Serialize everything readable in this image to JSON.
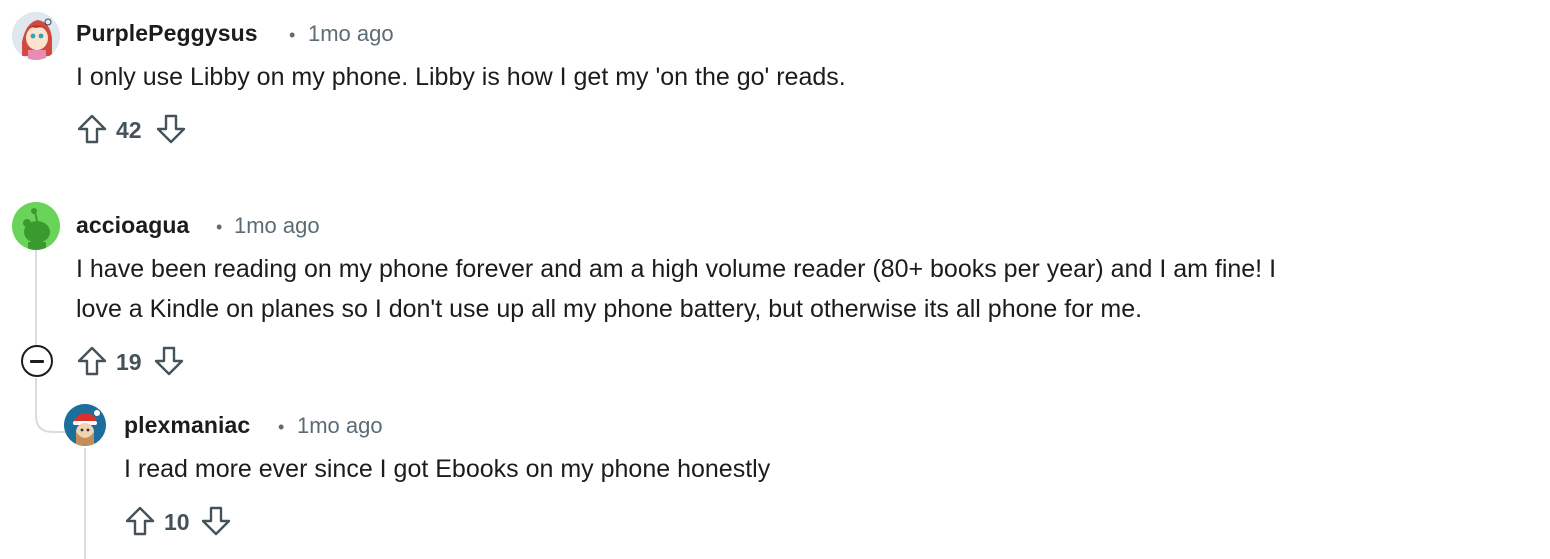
{
  "comments": [
    {
      "username": "PurplePeggysus",
      "separator": "•",
      "age": "1mo ago",
      "body": [
        "I only use Libby on my phone. Libby is how I get my 'on the go' reads."
      ],
      "votes": "42",
      "avatar_icon": "anime-avatar-icon"
    },
    {
      "username": "accioagua",
      "separator": "•",
      "age": "1mo ago",
      "body": [
        "I have been reading on my phone forever and am a high volume reader (80+ books per year) and I am fine! I",
        "love a Kindle on planes so I don't use up all my phone battery, but otherwise its all phone for me."
      ],
      "votes": "19",
      "avatar_icon": "snoo-avatar-icon",
      "avatar_color": "#6ad45a"
    },
    {
      "username": "plexmaniac",
      "separator": "•",
      "age": "1mo ago",
      "body": [
        "I read more ever since I got Ebooks on my phone honestly"
      ],
      "votes": "10",
      "avatar_icon": "santa-avatar-icon"
    }
  ],
  "icons": {
    "upvote": "arrow-up-outline-icon",
    "downvote": "arrow-down-outline-icon",
    "collapse": "minus-circle-icon"
  },
  "colors": {
    "text": "#1c1c1c",
    "meta": "#5c6c74",
    "thread_line": "#d7dde1"
  }
}
